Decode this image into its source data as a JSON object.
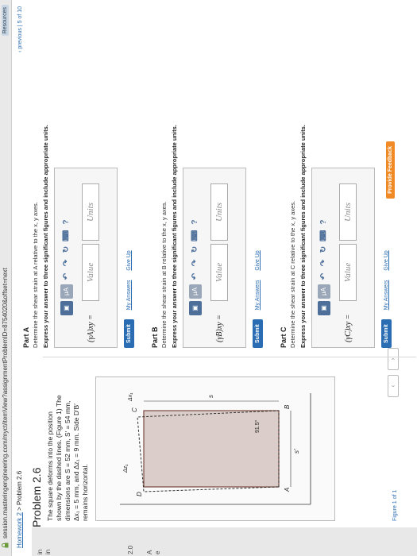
{
  "browser": {
    "url": "session.masteringengineering.com/myct/itemView?assignmentProblemID=8754020&offset=next",
    "resources": "Resources"
  },
  "breadcrumb": {
    "home": "Homework 2",
    "sep": ">",
    "current": "Problem 2.6"
  },
  "nav": {
    "previous": "‹ previous",
    "sep": "|",
    "position": "5 of 10"
  },
  "sidebar": {
    "items": [
      "in",
      "in",
      "2.0",
      "A",
      "e"
    ]
  },
  "problem": {
    "title": "Problem 2.6",
    "description": "The square deforms into the position shown by the dashed lines. (Figure 1) The dimensions are S = 52 mm, S′ = 54 mm, Δx₁ = 5 mm, and Δz₁ = 9 mm. Side D′B′ remains horizontal.",
    "figure_link": "Figure 1",
    "figure_nav": "Figure 1",
    "figure_of": "of 1",
    "figure_labels": {
      "A": "A",
      "B": "B",
      "C": "C",
      "D": "D",
      "angle": "91.5°",
      "s": "s",
      "dx1": "Δx₁",
      "dz1": "Δz₁",
      "sprime": "s′"
    }
  },
  "toolbar": {
    "templates": "▣",
    "mu": "μA",
    "undo": "↶",
    "redo": "↷",
    "reset": "↻",
    "keyboard": "⌨",
    "help": "?"
  },
  "parts": [
    {
      "label": "Part A",
      "question": "Determine the shear strain at A relative to the x, y axes.",
      "instruction": "Express your answer to three significant figures and include appropriate units.",
      "symbol": "(γA)xy =",
      "value_placeholder": "Value",
      "units_placeholder": "Units",
      "submit": "Submit",
      "my_answers": "My Answers",
      "give_up": "Give Up"
    },
    {
      "label": "Part B",
      "question": "Determine the shear strain at B relative to the x, y axes.",
      "instruction": "Express your answer to three significant figures and include appropriate units.",
      "symbol": "(γB)xy =",
      "value_placeholder": "Value",
      "units_placeholder": "Units",
      "submit": "Submit",
      "my_answers": "My Answers",
      "give_up": "Give Up"
    },
    {
      "label": "Part C",
      "question": "Determine the shear strain at C relative to the x, y axes.",
      "instruction": "Express your answer to three significant figures and include appropriate units.",
      "symbol": "(γC)xy =",
      "value_placeholder": "Value",
      "units_placeholder": "Units",
      "submit": "Submit",
      "my_answers": "My Answers",
      "give_up": "Give Up",
      "provide_feedback": "Provide Feedback"
    }
  ]
}
